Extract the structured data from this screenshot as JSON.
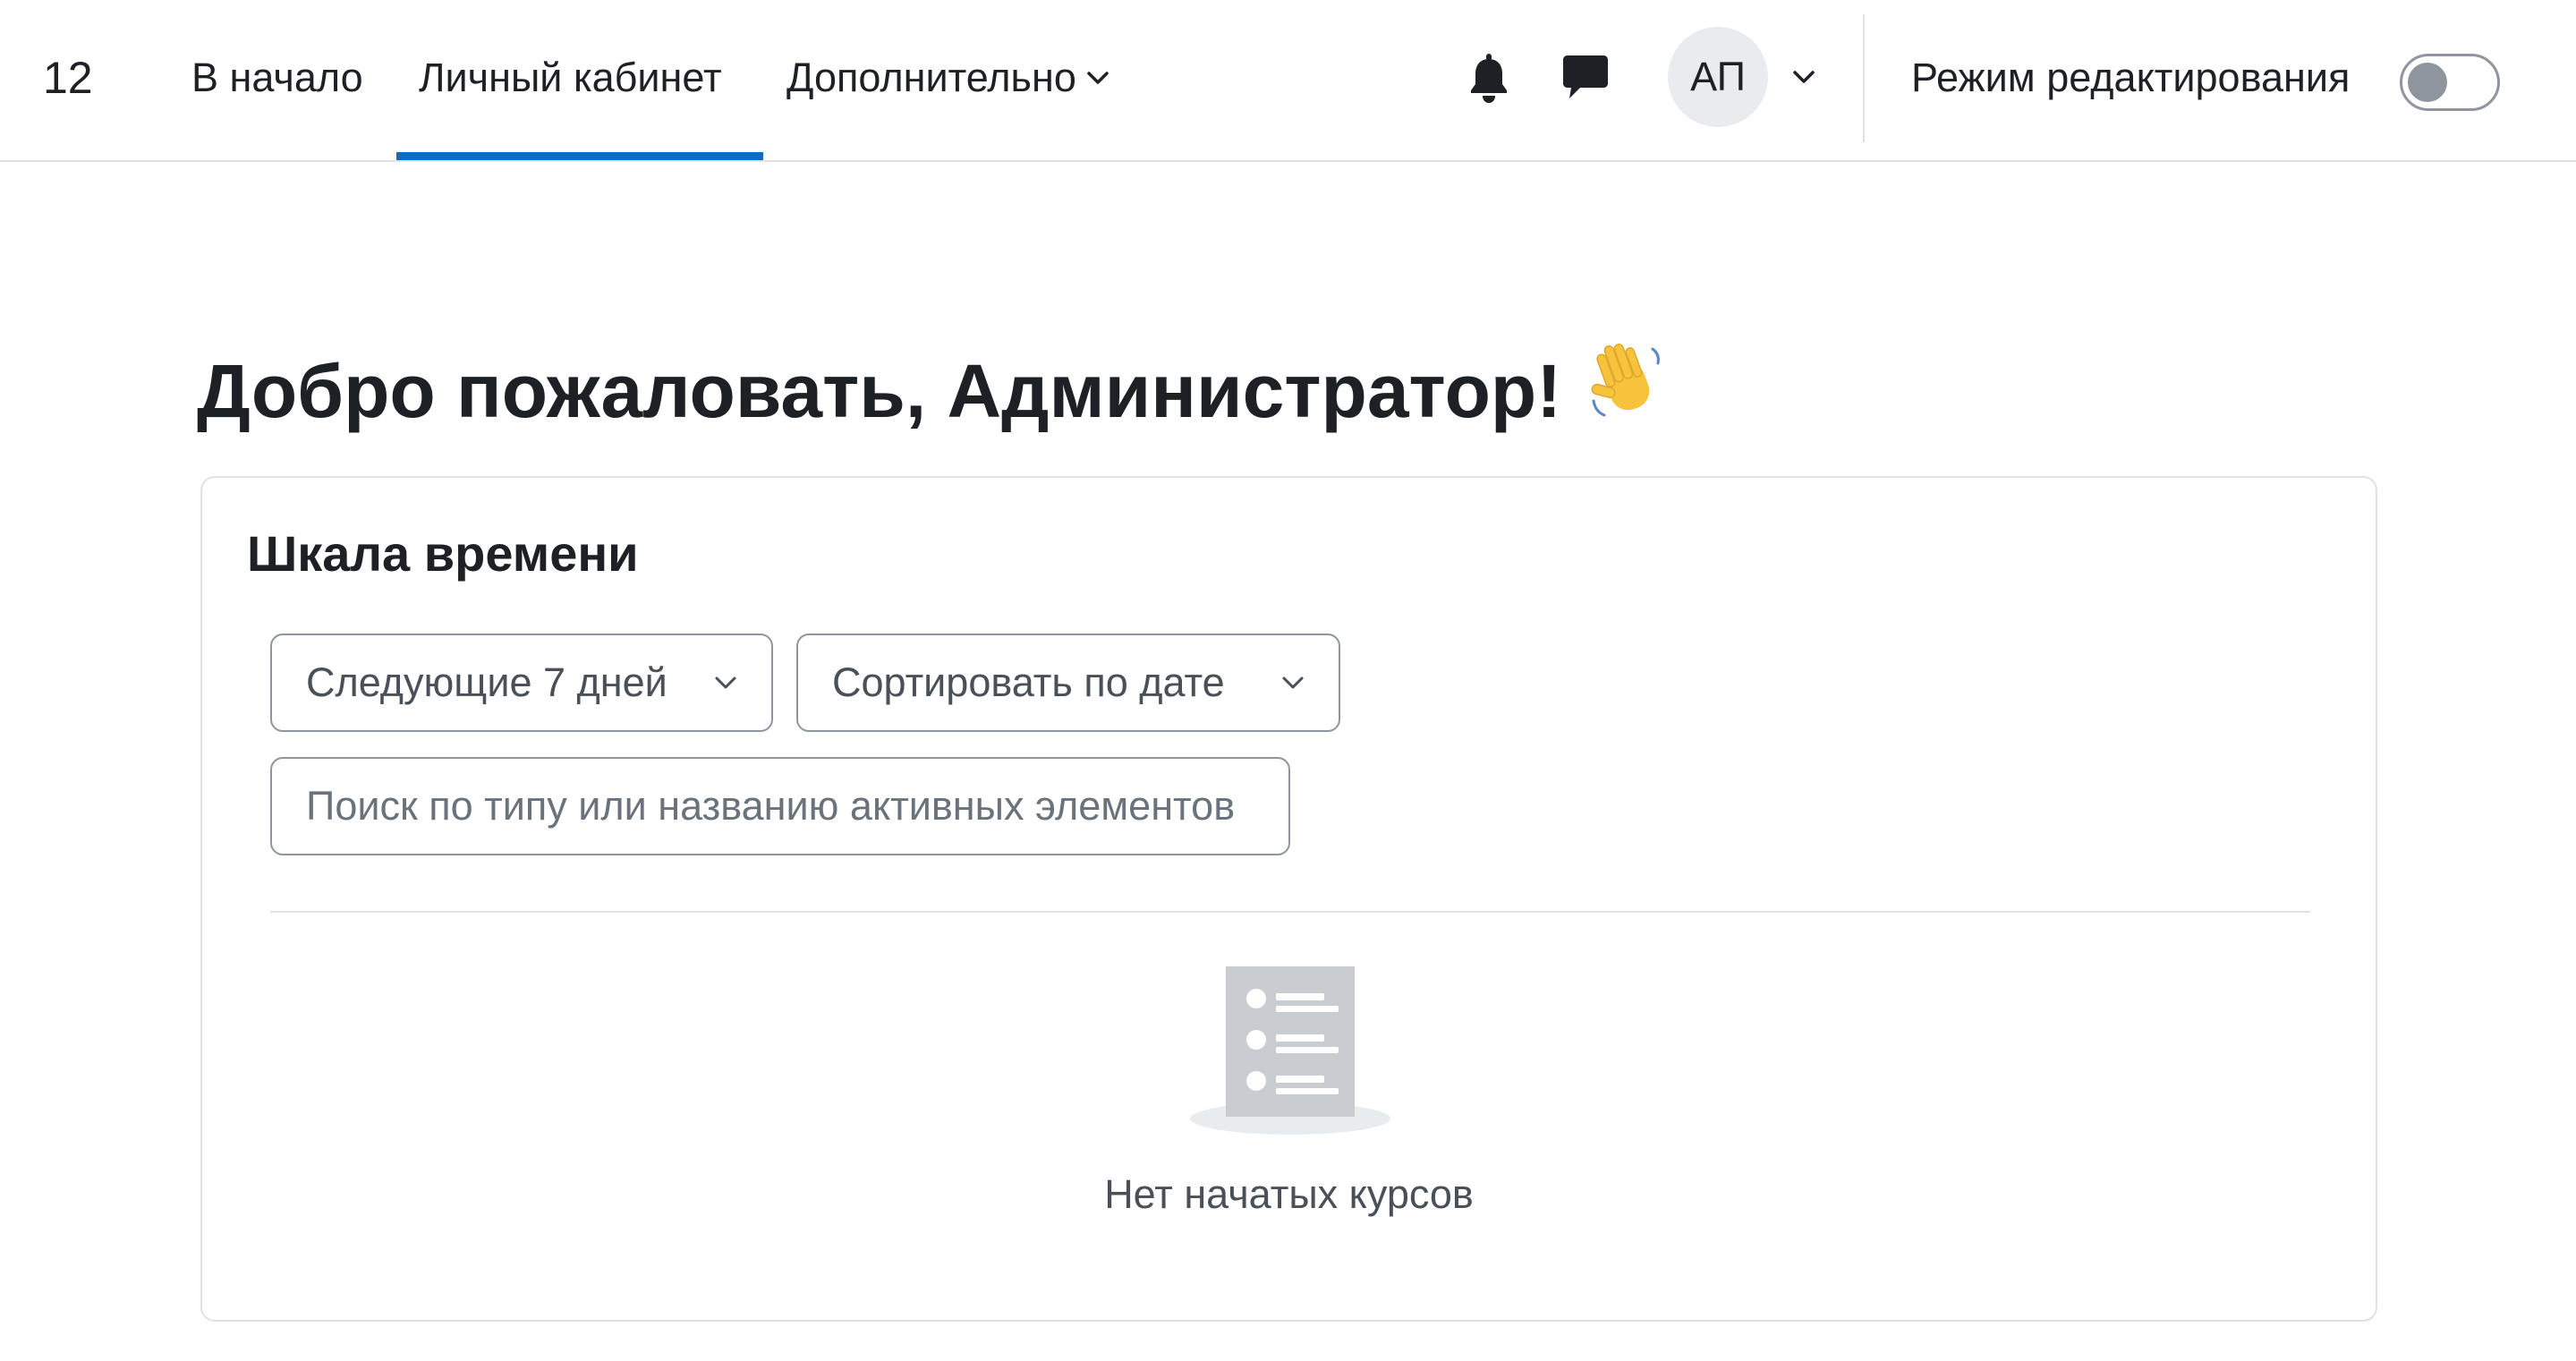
{
  "navbar": {
    "brand": "12",
    "items": [
      {
        "label": "В начало",
        "active": false
      },
      {
        "label": "Личный кабинет",
        "active": true
      },
      {
        "label": "Дополнительно",
        "active": false
      }
    ],
    "notifications_icon": "bell-icon",
    "messages_icon": "chat-icon",
    "user_initials": "АП",
    "edit_mode_label": "Режим редактирования",
    "edit_mode_on": false,
    "accent_color": "#0f6cbf"
  },
  "main": {
    "greeting": "Добро пожаловать, Администратор!",
    "greeting_icon": "waving-hand-icon"
  },
  "timeline": {
    "title": "Шкала времени",
    "filter_days": "Следующие 7 дней",
    "sort": "Сортировать по дате",
    "search_placeholder": "Поиск по типу или названию активных элементов",
    "empty_icon": "empty-list-icon",
    "empty_text": "Нет начатых курсов"
  }
}
